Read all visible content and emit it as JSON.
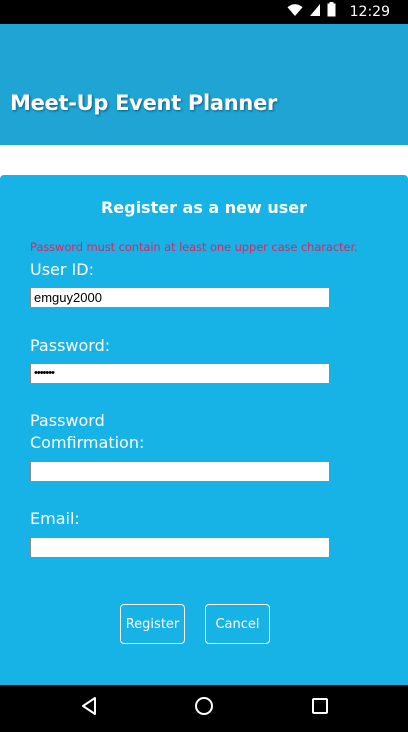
{
  "status_bar": {
    "time": "12:29"
  },
  "app_bar": {
    "title": "Meet-Up Event Planner"
  },
  "form": {
    "heading": "Register as a new user",
    "error": "Password must contain at least one upper case character.",
    "user_id": {
      "label": "User ID:",
      "value": "emguy2000"
    },
    "password": {
      "label": "Password:",
      "value": "•••••••"
    },
    "password_confirm": {
      "label_line1": "Password",
      "label_line2": "Comfirmation:",
      "value": ""
    },
    "email": {
      "label": "Email:",
      "value": ""
    },
    "register_label": "Register",
    "cancel_label": "Cancel"
  },
  "icons": {
    "wifi": "wifi-icon",
    "signal": "signal-icon",
    "battery": "battery-icon",
    "back": "back-icon",
    "home": "home-icon",
    "recents": "recents-icon"
  },
  "colors": {
    "app_bar": "#1fa4d4",
    "panel": "#17b3e6",
    "error": "#e0245e"
  }
}
